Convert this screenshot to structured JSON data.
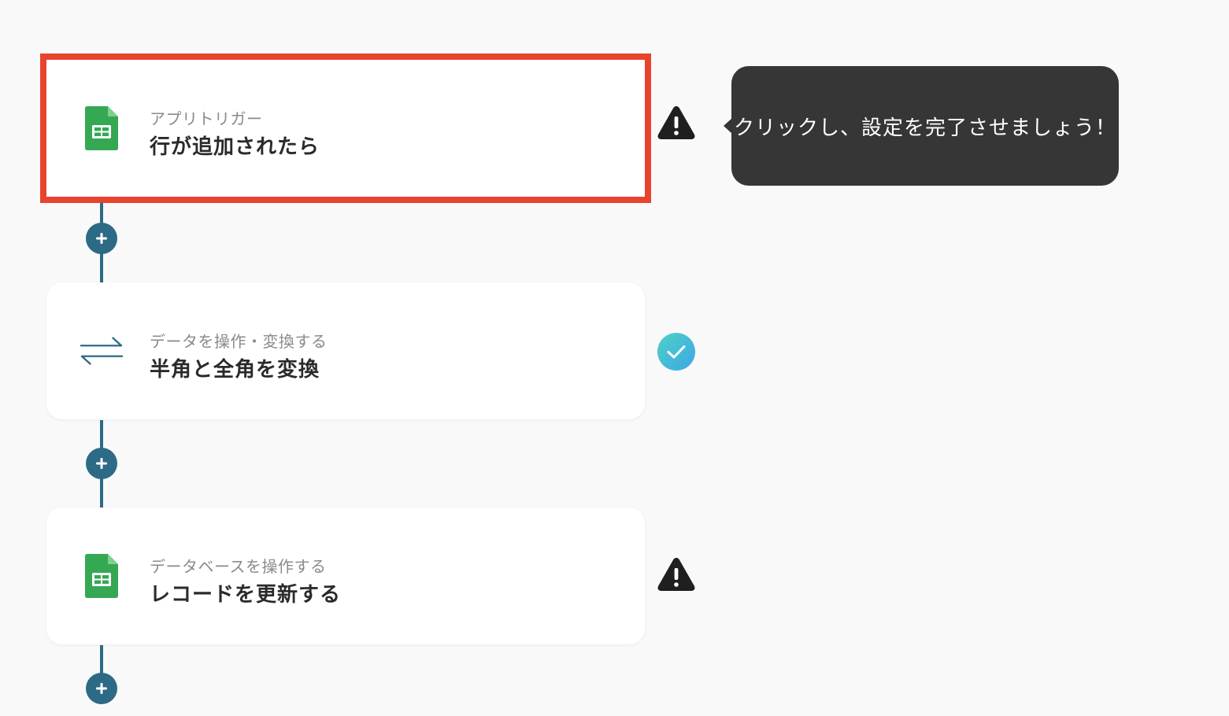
{
  "colors": {
    "highlight_border": "#e8442d",
    "connector": "#2d6a86",
    "sheets_green": "#34a853",
    "check_gradient": [
      "#4fd1c5",
      "#3ba7e6"
    ],
    "warning": "#1f1f1f",
    "tooltip_bg": "#363636"
  },
  "flow": {
    "steps": [
      {
        "icon": "google-sheets-icon",
        "category": "アプリトリガー",
        "title": "行が追加されたら",
        "status": "warning"
      },
      {
        "icon": "convert-arrows-icon",
        "category": "データを操作・変換する",
        "title": "半角と全角を変換",
        "status": "complete"
      },
      {
        "icon": "google-sheets-icon",
        "category": "データベースを操作する",
        "title": "レコードを更新する",
        "status": "warning"
      }
    ],
    "add_buttons": [
      "plus-icon",
      "plus-icon",
      "plus-icon"
    ]
  },
  "tooltip": {
    "text": "クリックし、設定を完了させましょう！"
  }
}
